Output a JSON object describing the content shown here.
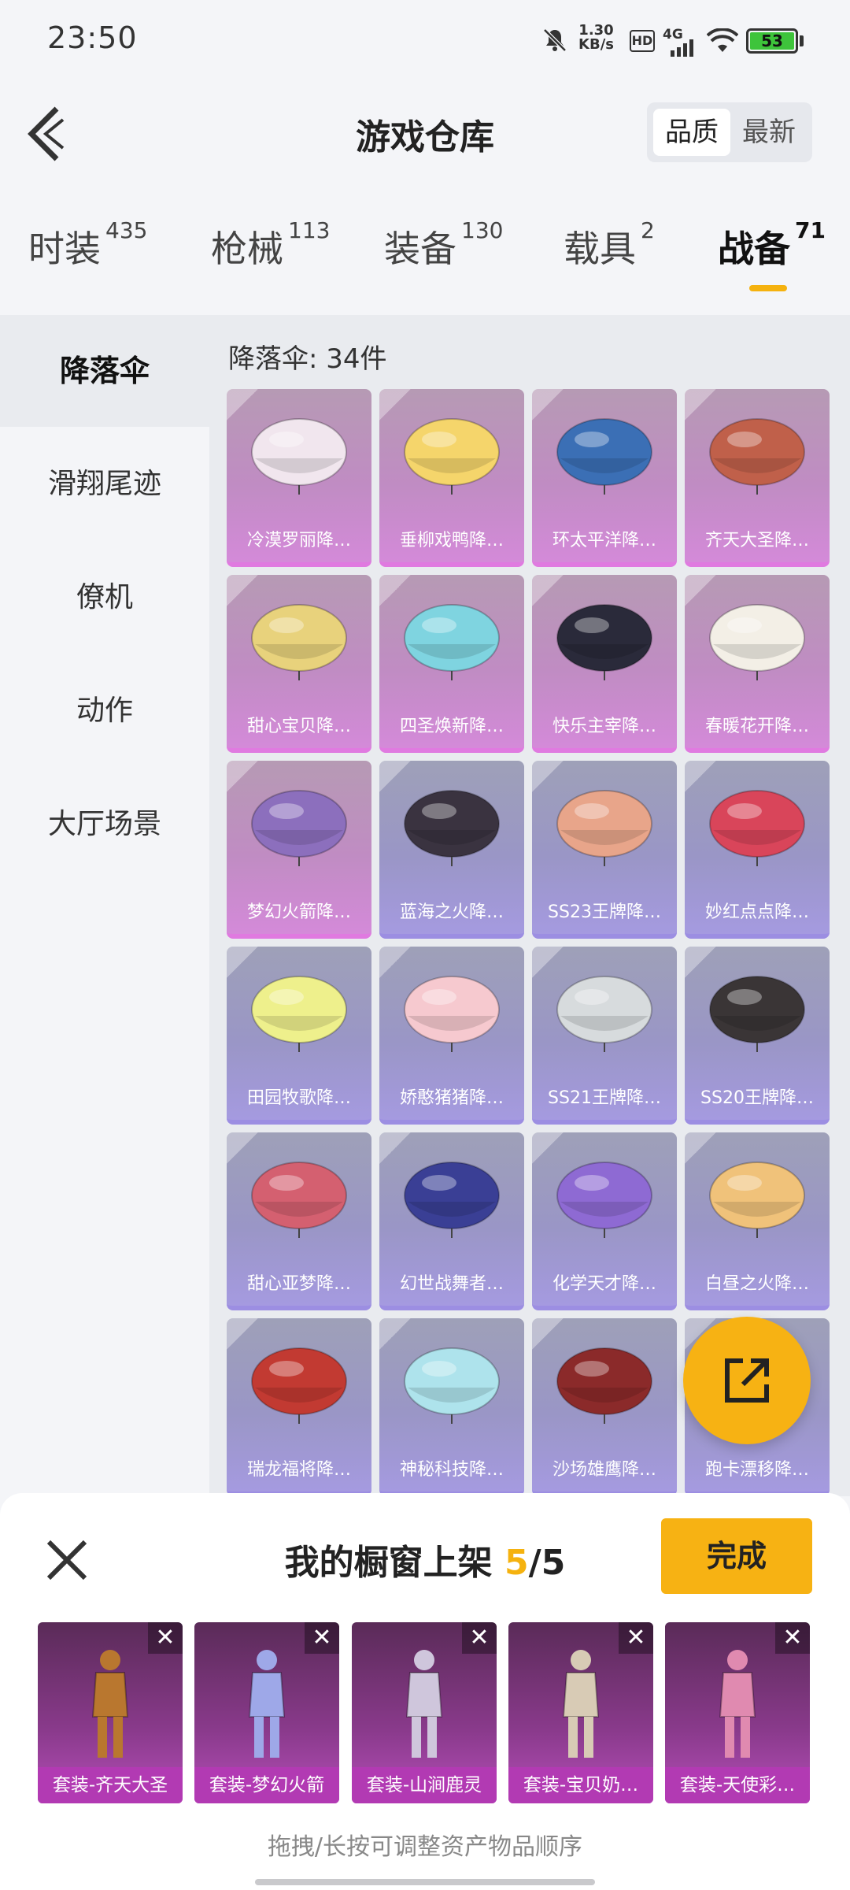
{
  "status_bar": {
    "time": "23:50",
    "speed_value": "1.30",
    "speed_unit": "KB/s",
    "hd": "HD",
    "network": "4G",
    "battery": "53"
  },
  "header": {
    "title": "游戏仓库",
    "sort_quality": "品质",
    "sort_newest": "最新"
  },
  "tabs": [
    {
      "label": "时装",
      "count": "435"
    },
    {
      "label": "枪械",
      "count": "113"
    },
    {
      "label": "装备",
      "count": "130"
    },
    {
      "label": "载具",
      "count": "2"
    },
    {
      "label": "战备",
      "count": "71"
    }
  ],
  "sidebar": {
    "items": [
      "降落伞",
      "滑翔尾迹",
      "僚机",
      "动作",
      "大厅场景"
    ]
  },
  "grid": {
    "title": "降落伞: 34件",
    "items": [
      {
        "label": "冷漠罗丽降…",
        "rarity": "pink",
        "color": "#f1e6ee"
      },
      {
        "label": "垂柳戏鸭降…",
        "rarity": "pink",
        "color": "#f5d56b"
      },
      {
        "label": "环太平洋降…",
        "rarity": "pink",
        "color": "#3b6fb5"
      },
      {
        "label": "齐天大圣降…",
        "rarity": "pink",
        "color": "#c0604a"
      },
      {
        "label": "甜心宝贝降…",
        "rarity": "pink",
        "color": "#e8d27c"
      },
      {
        "label": "四圣焕新降…",
        "rarity": "pink",
        "color": "#7fd4e0"
      },
      {
        "label": "快乐主宰降…",
        "rarity": "pink",
        "color": "#2a2a3a"
      },
      {
        "label": "春暖花开降…",
        "rarity": "pink",
        "color": "#f3efe6"
      },
      {
        "label": "梦幻火箭降…",
        "rarity": "pink",
        "color": "#8c6fbd"
      },
      {
        "label": "蓝海之火降…",
        "rarity": "purple",
        "color": "#3a3340"
      },
      {
        "label": "SS23王牌降…",
        "rarity": "purple",
        "color": "#e8a58a"
      },
      {
        "label": "妙红点点降…",
        "rarity": "purple",
        "color": "#d9455a"
      },
      {
        "label": "田园牧歌降…",
        "rarity": "purple",
        "color": "#eef08c"
      },
      {
        "label": "娇憨猪猪降…",
        "rarity": "purple",
        "color": "#f6c9cf"
      },
      {
        "label": "SS21王牌降…",
        "rarity": "purple",
        "color": "#d7dbdd"
      },
      {
        "label": "SS20王牌降…",
        "rarity": "purple",
        "color": "#3a3536"
      },
      {
        "label": "甜心亚梦降…",
        "rarity": "purple",
        "color": "#d46070"
      },
      {
        "label": "幻世战舞者…",
        "rarity": "purple",
        "color": "#3a3f95"
      },
      {
        "label": "化学天才降…",
        "rarity": "purple",
        "color": "#8e6ad3"
      },
      {
        "label": "白昼之火降…",
        "rarity": "purple",
        "color": "#f0c27a"
      },
      {
        "label": "瑞龙福将降…",
        "rarity": "purple",
        "color": "#c23a32"
      },
      {
        "label": "神秘科技降…",
        "rarity": "purple",
        "color": "#aee3ec"
      },
      {
        "label": "沙场雄鹰降…",
        "rarity": "purple",
        "color": "#8b2a2a"
      },
      {
        "label": "跑卡漂移降…",
        "rarity": "purple",
        "color": "#b9b0c9"
      }
    ]
  },
  "showcase": {
    "title_prefix": "我的橱窗上架",
    "current": "5",
    "separator": "/",
    "total": "5",
    "done_label": "完成",
    "items": [
      {
        "label": "套装-齐天大圣",
        "color": "#b9772f"
      },
      {
        "label": "套装-梦幻火箭",
        "color": "#9ea8e8"
      },
      {
        "label": "套装-山涧鹿灵",
        "color": "#cfc6dc"
      },
      {
        "label": "套装-宝贝奶…",
        "color": "#d8cbb5"
      },
      {
        "label": "套装-天使彩…",
        "color": "#e08ab0"
      }
    ],
    "hint": "拖拽/长按可调整资产物品顺序"
  },
  "icons": {
    "back": "back-arrow-icon",
    "close": "close-icon",
    "share": "share-external-icon",
    "remove": "remove-x-icon"
  },
  "colors": {
    "accent": "#f7b213",
    "rarity_pink": "#d48ad9",
    "rarity_purple": "#a59ae0"
  }
}
